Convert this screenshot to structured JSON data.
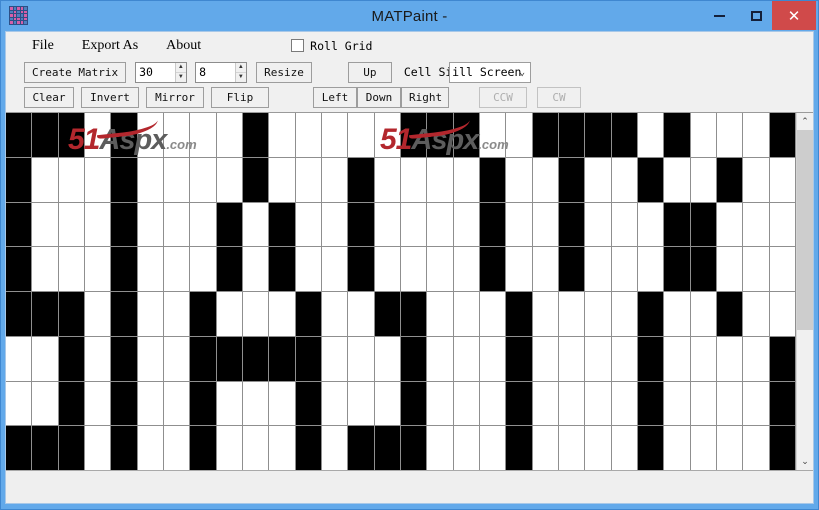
{
  "window": {
    "title": "MATPaint -",
    "icon_name": "matrix-app-icon",
    "minimize_label": "",
    "maximize_label": "",
    "close_label": "✕"
  },
  "menu": {
    "items": [
      {
        "label": "File"
      },
      {
        "label": "Export As"
      },
      {
        "label": "About"
      }
    ],
    "roll_grid": {
      "label": "Roll Grid",
      "checked": false
    }
  },
  "toolbar": {
    "create_matrix_label": "Create Matrix",
    "cols_value": "30",
    "rows_value": "8",
    "resize_label": "Resize",
    "up_label": "Up",
    "cell_size_label": "Cell Size",
    "cell_size_value": "ill Screen",
    "cell_size_options": [
      "Fill Screen"
    ],
    "clear_label": "Clear",
    "invert_label": "Invert",
    "mirror_label": "Mirror",
    "flip_label": "Flip",
    "left_label": "Left",
    "down_label": "Down",
    "right_label": "Right",
    "ccw_label": "CCW",
    "cw_label": "CW"
  },
  "watermark": {
    "prefix": "51",
    "mid": "A",
    "word": "spx",
    "suffix": ".com"
  },
  "scrollbar": {
    "up_arrow": "⌃",
    "down_arrow": "⌄"
  },
  "grid": {
    "columns": 30,
    "rows": 8,
    "on_color": "#000000",
    "off_color": "#ffffff",
    "line_color": "#8f8f8f",
    "matrix": [
      [
        1,
        1,
        1,
        0,
        1,
        0,
        0,
        0,
        0,
        1,
        0,
        0,
        0,
        0,
        0,
        1,
        1,
        1,
        0,
        0,
        1,
        1,
        1,
        1,
        0,
        1,
        0,
        0,
        0,
        1
      ],
      [
        1,
        0,
        0,
        0,
        1,
        0,
        0,
        0,
        0,
        1,
        0,
        0,
        0,
        1,
        0,
        0,
        0,
        0,
        1,
        0,
        0,
        1,
        0,
        0,
        1,
        0,
        0,
        1,
        0,
        0
      ],
      [
        1,
        0,
        0,
        0,
        1,
        0,
        0,
        0,
        1,
        0,
        1,
        0,
        0,
        1,
        0,
        0,
        0,
        0,
        1,
        0,
        0,
        1,
        0,
        0,
        0,
        1,
        1,
        0,
        0,
        0
      ],
      [
        1,
        0,
        0,
        0,
        1,
        0,
        0,
        0,
        1,
        0,
        1,
        0,
        0,
        1,
        0,
        0,
        0,
        0,
        1,
        0,
        0,
        1,
        0,
        0,
        0,
        1,
        1,
        0,
        0,
        0
      ],
      [
        1,
        1,
        1,
        0,
        1,
        0,
        0,
        1,
        0,
        0,
        0,
        1,
        0,
        0,
        1,
        1,
        0,
        0,
        0,
        1,
        0,
        0,
        0,
        0,
        1,
        0,
        0,
        1,
        0,
        0
      ],
      [
        0,
        0,
        1,
        0,
        1,
        0,
        0,
        1,
        1,
        1,
        1,
        1,
        0,
        0,
        0,
        1,
        0,
        0,
        0,
        1,
        0,
        0,
        0,
        0,
        1,
        0,
        0,
        0,
        0,
        1
      ],
      [
        0,
        0,
        1,
        0,
        1,
        0,
        0,
        1,
        0,
        0,
        0,
        1,
        0,
        0,
        0,
        1,
        0,
        0,
        0,
        1,
        0,
        0,
        0,
        0,
        1,
        0,
        0,
        0,
        0,
        1
      ],
      [
        1,
        1,
        1,
        0,
        1,
        0,
        0,
        1,
        0,
        0,
        0,
        1,
        0,
        1,
        1,
        1,
        0,
        0,
        0,
        1,
        0,
        0,
        0,
        0,
        1,
        0,
        0,
        0,
        0,
        1
      ]
    ]
  }
}
